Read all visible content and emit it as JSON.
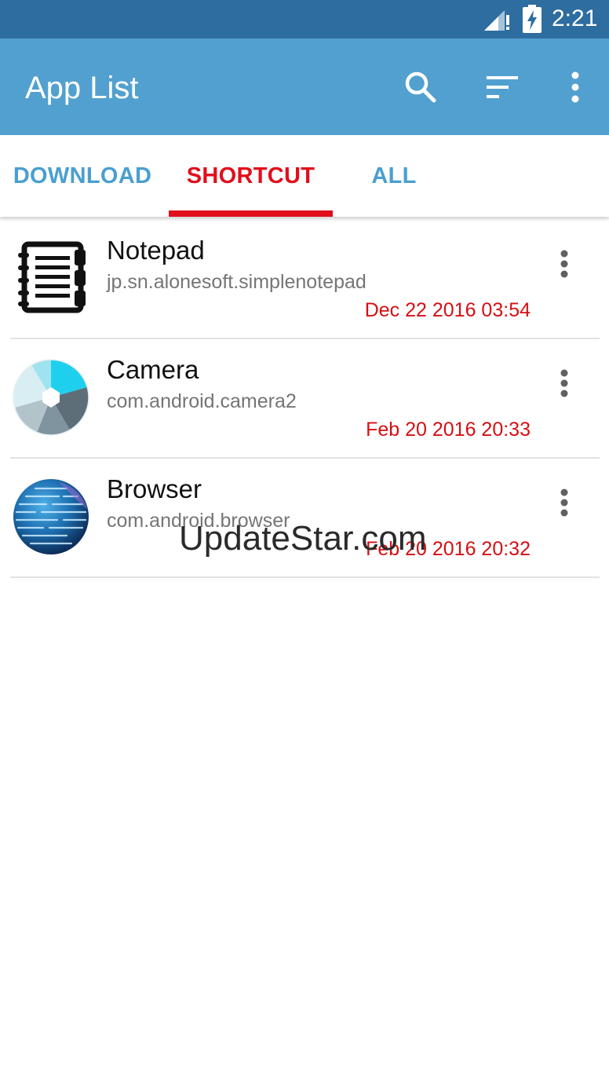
{
  "status_bar": {
    "time": "2:21",
    "icons": [
      "signal-no-data-icon",
      "battery-charging-icon"
    ]
  },
  "app_bar": {
    "title": "App List",
    "actions": [
      "search-icon",
      "sort-icon",
      "more-vert-icon"
    ]
  },
  "tabs": [
    {
      "label": "DOWNLOAD",
      "selected": false
    },
    {
      "label": "SHORTCUT",
      "selected": true
    },
    {
      "label": "ALL",
      "selected": false
    }
  ],
  "apps": [
    {
      "name": "Notepad",
      "package": "jp.sn.alonesoft.simplenotepad",
      "date": "Dec 22 2016 03:54",
      "icon": "notepad-icon"
    },
    {
      "name": "Camera",
      "package": "com.android.camera2",
      "date": "Feb 20 2016 20:33",
      "icon": "camera-icon"
    },
    {
      "name": "Browser",
      "package": "com.android.browser",
      "date": "Feb 20 2016 20:32",
      "icon": "browser-globe-icon"
    }
  ],
  "watermark": "UpdateStar.com",
  "colors": {
    "status_bar": "#2e6da0",
    "app_bar": "#52a0cf",
    "tab_inactive": "#4a9fd0",
    "tab_active": "#e10e1c",
    "date_text": "#d50f13"
  }
}
